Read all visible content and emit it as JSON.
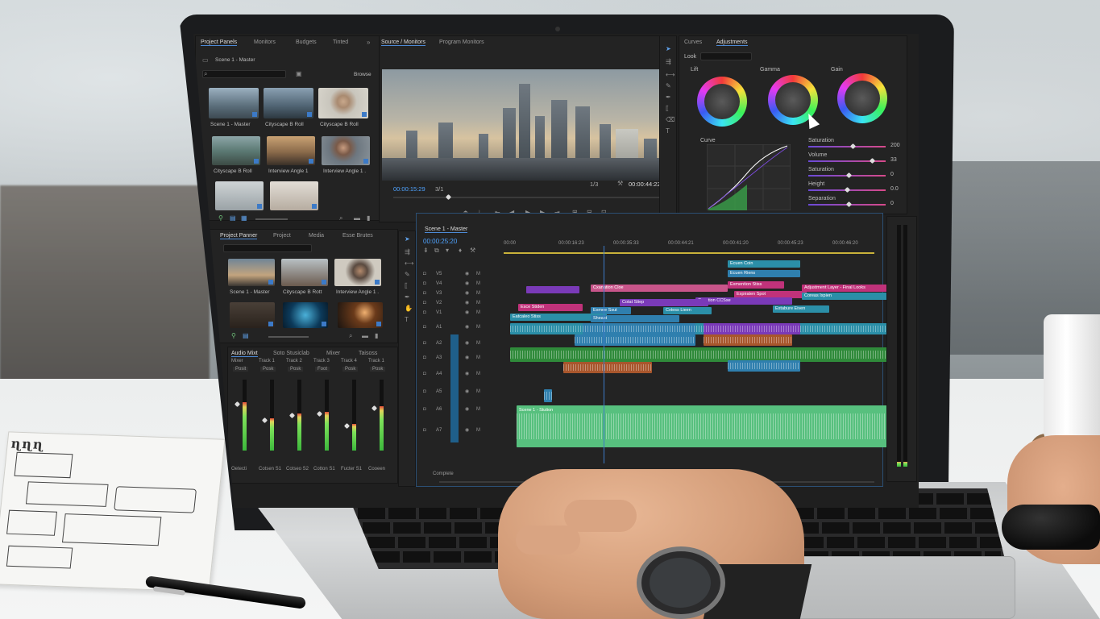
{
  "scene": {
    "description_tags": [
      "office-desk",
      "laptop",
      "video-editor",
      "notebook",
      "pen",
      "coffee-mug",
      "wristwatch",
      "mouse"
    ]
  },
  "editor": {
    "project_panel": {
      "tabs": [
        "Project Panels",
        "Monitors",
        "Budgets",
        "Tinted"
      ],
      "bin_title": "Scene 1 - Master",
      "search_right": "Browse",
      "thumbs": [
        "Scene 1 - Master",
        "Cityscape B Roll",
        "Cityscape B Roll",
        "Cityscape B Roll",
        "Interview Angle 1",
        "Interview Angle 1 ."
      ]
    },
    "project_panel2": {
      "tabs": [
        "Project Panner",
        "Project",
        "Media",
        "Esse Brutes"
      ],
      "thumbs": [
        "Scene 1 - Master",
        "Cityscape B Rott",
        "Interview Angle 1 ."
      ]
    },
    "audio_mixer": {
      "tabs": [
        "Audio Mixt",
        "Soto Stusiclab",
        "Mixer",
        "Taisoss"
      ],
      "channels": [
        {
          "name": "Mixer",
          "mode": "Posit",
          "label": "Oetecti",
          "level": 0.68
        },
        {
          "name": "Track 1",
          "mode": "Posk",
          "label": "Cotsen S1",
          "level": 0.45
        },
        {
          "name": "Track 2",
          "mode": "Posk",
          "label": "Cotseo S2",
          "level": 0.52
        },
        {
          "name": "Track 3",
          "mode": "Foot",
          "label": "Cotton S1",
          "level": 0.55
        },
        {
          "name": "Track 4",
          "mode": "Posk",
          "label": "Fucter S1",
          "level": 0.38
        },
        {
          "name": "Track 1",
          "mode": "Posk",
          "label": "Cooeen",
          "level": 0.62
        }
      ]
    },
    "source_monitor": {
      "tabs": [
        "Source / Monitors",
        "Program Monitors"
      ],
      "timecode_in": "00:00:15:29",
      "fit": "3/1",
      "quality": "1/3",
      "timecode_out": "00:00:44:22"
    },
    "lumetri": {
      "tabs": [
        "Curves",
        "Adjustments"
      ],
      "preset_label": "Look",
      "wheels": [
        "Lift",
        "Gamma",
        "Gain"
      ],
      "curve_label": "Curve",
      "sliders": [
        {
          "label": "Saturation",
          "value": "200",
          "position": 0.55
        },
        {
          "label": "Volume",
          "value": "33",
          "position": 0.8
        },
        {
          "label": "Saturation",
          "value": "0",
          "position": 0.5
        },
        {
          "label": "Height",
          "value": "0.0",
          "position": 0.48
        },
        {
          "label": "Separation",
          "value": "0",
          "position": 0.5
        }
      ]
    },
    "timeline": {
      "sequence_tab": "Scene 1 - Master",
      "timecode": "00:00:25:20",
      "ruler": [
        "00:00",
        "00:00:16:23",
        "00:00:35:33",
        "00:00:44:21",
        "00:00:41:20",
        "00:00:45:23",
        "00:00:46:20"
      ],
      "clip_labels": {
        "v_top1": "Ecuen Coin",
        "v_top2": "Ecuen Riens",
        "v_top3": "Exmention Stiss",
        "v_pink": "Cxanation Cloe",
        "v_pink2": "Expiraten Spot",
        "v_purple": "Ceastion CCSse",
        "v_right": "Adjustment Layer - Final Looks",
        "v_teal": "Coreas Ixpien",
        "v_small1": "Esce Stiden",
        "v_small2": "Cotat Stiep",
        "v_small3": "Exmee Ssut",
        "v_small4": "Cxtess Lieen",
        "v_small5": "Extabure Eiven",
        "v_small6": "Eatcaleo Stiss",
        "v_small7": "Sheast",
        "audio_main": "Scene 1 - Stution"
      },
      "track_names": [
        "V5",
        "V4",
        "V3",
        "V2",
        "V1",
        "A1",
        "A2",
        "A3",
        "A4",
        "A5",
        "A6",
        "A7"
      ],
      "bottom_label": "Complete"
    }
  },
  "colors": {
    "accent_blue": "#4d8ad6",
    "clip_blue": "#2f7fae",
    "clip_pink": "#c0327a",
    "clip_purple": "#7a3ab8",
    "clip_teal": "#2b8fa8",
    "audio_green": "#2f8a3a",
    "audio_lightgreen": "#57c07e",
    "audio_orange": "#a8562c"
  }
}
